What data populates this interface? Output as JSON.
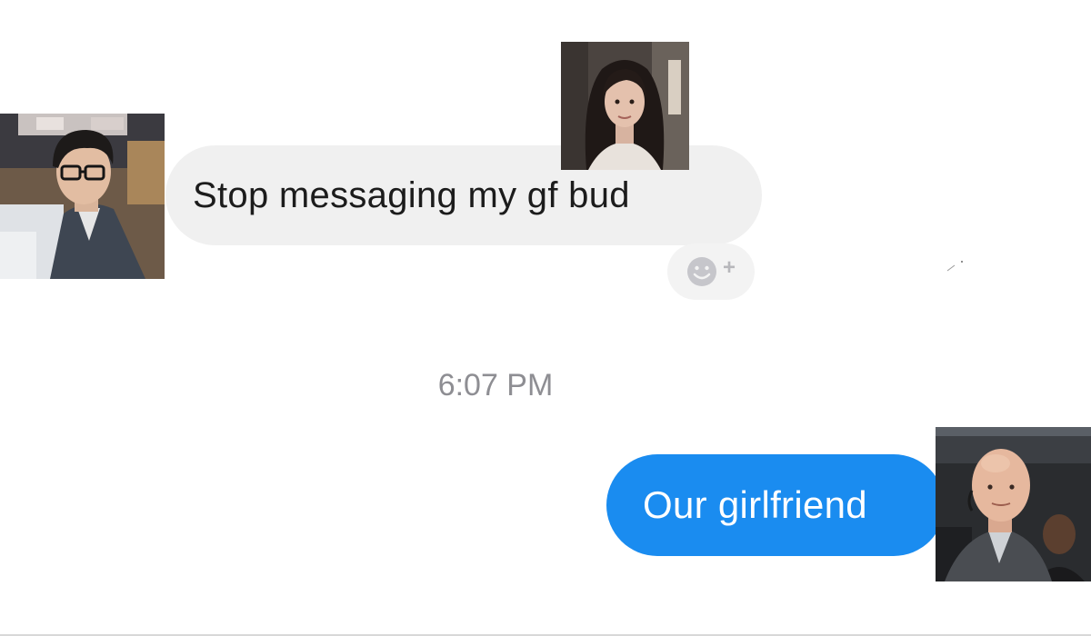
{
  "conversation": {
    "incoming_message": "Stop messaging my gf bud",
    "timestamp": "6:07 PM",
    "outgoing_message": "Our girlfriend"
  },
  "reaction_button": {
    "icon": "smiley-add-reaction-icon",
    "plus_glyph": "+"
  },
  "avatars": {
    "left": "man-with-glasses-photo",
    "top": "woman-dark-hair-photo",
    "right": "bald-man-suit-photo"
  },
  "colors": {
    "incoming_bubble": "#f0f0f0",
    "outgoing_bubble": "#1a8cf0",
    "timestamp_text": "#8e8e93"
  }
}
